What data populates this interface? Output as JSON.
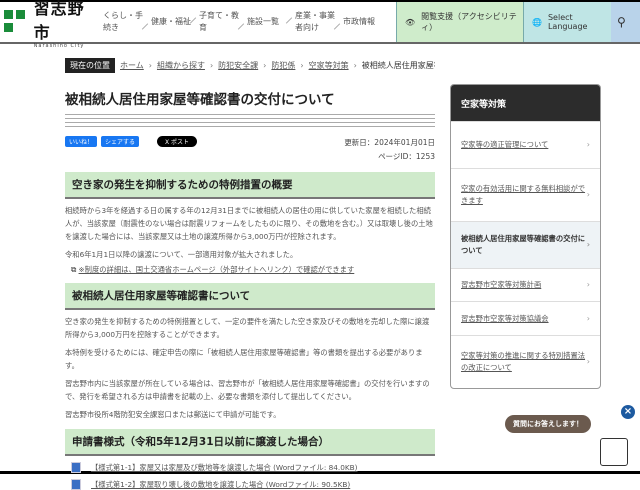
{
  "header": {
    "logo_title": "習志野市",
    "logo_sub": "Narashino City",
    "nav": [
      "くらし・手続き",
      "健康・福祉",
      "子育て・教育",
      "施設一覧",
      "産業・事業者向け",
      "市政情報"
    ],
    "accessibility": "閲覧支援（アクセシビリティ）",
    "language": "Select Language"
  },
  "breadcrumb": {
    "here": "現在の位置",
    "items": [
      "ホーム",
      "組織から探す",
      "防犯安全課",
      "防犯係",
      "空家等対策",
      "被相続人居住用家屋等確認書の交付について"
    ]
  },
  "page": {
    "title": "被相続人居住用家屋等確認書の交付について",
    "like": "いいね！",
    "share": "シェアする",
    "post": "X ポスト",
    "updated": "更新日：2024年01月01日",
    "page_id": "ページID：1253"
  },
  "sections": [
    {
      "heading": "空き家の発生を抑制するための特例措置の概要",
      "paragraphs": [
        "相続時から3年を経過する日の属する年の12月31日までに被相続人の居住の用に供していた家屋を相続した相続人が、当該家屋（耐震性のない場合は耐震リフォームをしたものに限り、その敷地を含む。）又は取壊し後の土地を譲渡した場合には、当該家屋又は土地の譲渡所得から3,000万円が控除されます。",
        "令和6年1月1日以降の譲渡について、一部適用対象が拡大されました。"
      ],
      "link": "※制度の詳細は、国土交通省ホームページ（外部サイトへリンク）で確認ができます"
    },
    {
      "heading": "被相続人居住用家屋等確認書について",
      "paragraphs": [
        "空き家の発生を抑制するための特例措置として、一定の要件を満たした空き家及びその敷地を売却した際に譲渡所得から3,000万円を控除することができます。",
        "本特例を受けるためには、確定申告の際に「被相続人居住用家屋等確認書」等の書類を提出する必要があります。",
        "習志野市内に当該家屋が所在している場合は、習志野市が「被相続人居住用家屋等確認書」の交付を行いますので、発行を希望される方は申請書を記載の上、必要な書類を添付して提出してください。",
        "習志野市役所4階防犯安全課窓口または郵送にて申請が可能です。"
      ]
    },
    {
      "heading": "申請書様式（令和5年12月31日以前に譲渡した場合）",
      "files": [
        "【様式第1-1】家屋又は家屋及び敷地等を譲渡した場合 (Wordファイル: 84.0KB)",
        "【様式第1-2】家屋取り壊し後の敷地を譲渡した場合 (Wordファイル: 90.5KB)"
      ]
    }
  ],
  "sidebar": {
    "title": "空家等対策",
    "items": [
      "空家等の適正管理について",
      "空家の有効活用に関する無料相談ができます",
      "被相続人居住用家屋等確認書の交付について",
      "習志野市空家等対策計画",
      "習志野市空家等対策協議会",
      "空家等対策の推進に関する特別措置法の改正について"
    ]
  },
  "chat": {
    "bubble": "質問にお答えします！"
  }
}
